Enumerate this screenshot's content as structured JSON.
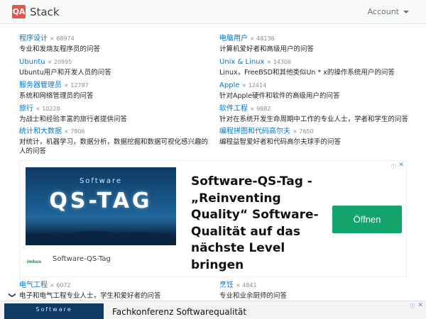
{
  "header": {
    "logo_mark": "QA",
    "logo_text": "Stack",
    "account_label": "Account"
  },
  "sites": [
    {
      "name": "程序设计",
      "count": "× 68974",
      "desc": "专业和发烧友程序员的问答"
    },
    {
      "name": "电脑用户",
      "count": "× 48136",
      "desc": "计算机爱好者和高级用户的问答"
    },
    {
      "name": "Ubuntu",
      "count": "× 20995",
      "desc": "Ubuntu用户和开发人员的问答"
    },
    {
      "name": "Unix & Linux",
      "count": "× 14306",
      "desc": "Linux，FreeBSD和其他类似Un * x的操作系统用户的问答"
    },
    {
      "name": "服务器管理员",
      "count": "× 12787",
      "desc": "系统和网络管理员的问答"
    },
    {
      "name": "Apple",
      "count": "× 12414",
      "desc": "针对Apple硬件和软件的高级用户的问答"
    },
    {
      "name": "旅行",
      "count": "× 10228",
      "desc": "为战士和经验丰富的旅行者提供问答"
    },
    {
      "name": "软件工程",
      "count": "× 9882",
      "desc": "针对在系统开发生命周期中工作的专业人士，学者和学生的问答"
    },
    {
      "name": "统计和大数据",
      "count": "× 7806",
      "desc": "对统计，机器学习，数据分析，数据挖掘和数据可视化感兴趣的人的问答"
    },
    {
      "name": "编程拼图和代码高尔夫",
      "count": "× 7650",
      "desc": "编程益智爱好者和代码高尔夫球手的问答"
    }
  ],
  "bottom_sites": [
    {
      "name": "电气工程",
      "count": "× 6072",
      "desc": "电子和电气工程专业人士，学生和爱好者的问答"
    },
    {
      "name": "烹饪",
      "count": "× 4841",
      "desc": "专业和业余厨师的问答"
    }
  ],
  "ad": {
    "image_small": "Software",
    "image_big": "QS-TAG",
    "headline": "Software-QS-Tag - „Reinventing Quality“ Software-Qualität auf das nächste Level bringen",
    "button": "Öffnen",
    "logo": "imbus",
    "sponsor": "Software-QS-Tag",
    "info_icon": "ⓘ",
    "close_icon": "✕"
  },
  "sticky_ad": {
    "image_small": "Software",
    "text": "Fachkonferenz Softwarequalität",
    "info_icon": "ⓘ",
    "close_icon": "✕"
  },
  "chevron": "❯"
}
